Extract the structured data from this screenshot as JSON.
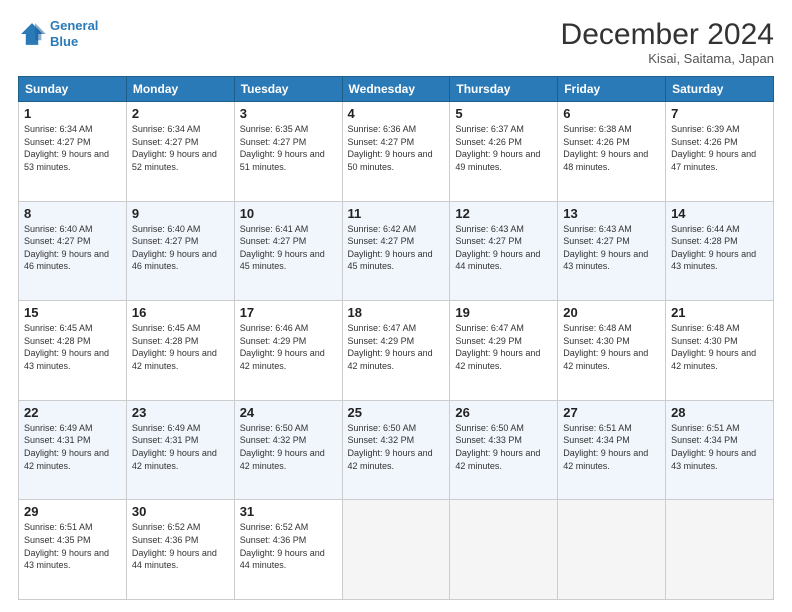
{
  "header": {
    "logo_line1": "General",
    "logo_line2": "Blue",
    "month": "December 2024",
    "location": "Kisai, Saitama, Japan"
  },
  "weekdays": [
    "Sunday",
    "Monday",
    "Tuesday",
    "Wednesday",
    "Thursday",
    "Friday",
    "Saturday"
  ],
  "weeks": [
    [
      {
        "day": "1",
        "rise": "6:34 AM",
        "set": "4:27 PM",
        "daylight": "9 hours and 53 minutes."
      },
      {
        "day": "2",
        "rise": "6:34 AM",
        "set": "4:27 PM",
        "daylight": "9 hours and 52 minutes."
      },
      {
        "day": "3",
        "rise": "6:35 AM",
        "set": "4:27 PM",
        "daylight": "9 hours and 51 minutes."
      },
      {
        "day": "4",
        "rise": "6:36 AM",
        "set": "4:27 PM",
        "daylight": "9 hours and 50 minutes."
      },
      {
        "day": "5",
        "rise": "6:37 AM",
        "set": "4:26 PM",
        "daylight": "9 hours and 49 minutes."
      },
      {
        "day": "6",
        "rise": "6:38 AM",
        "set": "4:26 PM",
        "daylight": "9 hours and 48 minutes."
      },
      {
        "day": "7",
        "rise": "6:39 AM",
        "set": "4:26 PM",
        "daylight": "9 hours and 47 minutes."
      }
    ],
    [
      {
        "day": "8",
        "rise": "6:40 AM",
        "set": "4:27 PM",
        "daylight": "9 hours and 46 minutes."
      },
      {
        "day": "9",
        "rise": "6:40 AM",
        "set": "4:27 PM",
        "daylight": "9 hours and 46 minutes."
      },
      {
        "day": "10",
        "rise": "6:41 AM",
        "set": "4:27 PM",
        "daylight": "9 hours and 45 minutes."
      },
      {
        "day": "11",
        "rise": "6:42 AM",
        "set": "4:27 PM",
        "daylight": "9 hours and 45 minutes."
      },
      {
        "day": "12",
        "rise": "6:43 AM",
        "set": "4:27 PM",
        "daylight": "9 hours and 44 minutes."
      },
      {
        "day": "13",
        "rise": "6:43 AM",
        "set": "4:27 PM",
        "daylight": "9 hours and 43 minutes."
      },
      {
        "day": "14",
        "rise": "6:44 AM",
        "set": "4:28 PM",
        "daylight": "9 hours and 43 minutes."
      }
    ],
    [
      {
        "day": "15",
        "rise": "6:45 AM",
        "set": "4:28 PM",
        "daylight": "9 hours and 43 minutes."
      },
      {
        "day": "16",
        "rise": "6:45 AM",
        "set": "4:28 PM",
        "daylight": "9 hours and 42 minutes."
      },
      {
        "day": "17",
        "rise": "6:46 AM",
        "set": "4:29 PM",
        "daylight": "9 hours and 42 minutes."
      },
      {
        "day": "18",
        "rise": "6:47 AM",
        "set": "4:29 PM",
        "daylight": "9 hours and 42 minutes."
      },
      {
        "day": "19",
        "rise": "6:47 AM",
        "set": "4:29 PM",
        "daylight": "9 hours and 42 minutes."
      },
      {
        "day": "20",
        "rise": "6:48 AM",
        "set": "4:30 PM",
        "daylight": "9 hours and 42 minutes."
      },
      {
        "day": "21",
        "rise": "6:48 AM",
        "set": "4:30 PM",
        "daylight": "9 hours and 42 minutes."
      }
    ],
    [
      {
        "day": "22",
        "rise": "6:49 AM",
        "set": "4:31 PM",
        "daylight": "9 hours and 42 minutes."
      },
      {
        "day": "23",
        "rise": "6:49 AM",
        "set": "4:31 PM",
        "daylight": "9 hours and 42 minutes."
      },
      {
        "day": "24",
        "rise": "6:50 AM",
        "set": "4:32 PM",
        "daylight": "9 hours and 42 minutes."
      },
      {
        "day": "25",
        "rise": "6:50 AM",
        "set": "4:32 PM",
        "daylight": "9 hours and 42 minutes."
      },
      {
        "day": "26",
        "rise": "6:50 AM",
        "set": "4:33 PM",
        "daylight": "9 hours and 42 minutes."
      },
      {
        "day": "27",
        "rise": "6:51 AM",
        "set": "4:34 PM",
        "daylight": "9 hours and 42 minutes."
      },
      {
        "day": "28",
        "rise": "6:51 AM",
        "set": "4:34 PM",
        "daylight": "9 hours and 43 minutes."
      }
    ],
    [
      {
        "day": "29",
        "rise": "6:51 AM",
        "set": "4:35 PM",
        "daylight": "9 hours and 43 minutes."
      },
      {
        "day": "30",
        "rise": "6:52 AM",
        "set": "4:36 PM",
        "daylight": "9 hours and 44 minutes."
      },
      {
        "day": "31",
        "rise": "6:52 AM",
        "set": "4:36 PM",
        "daylight": "9 hours and 44 minutes."
      },
      null,
      null,
      null,
      null
    ]
  ]
}
